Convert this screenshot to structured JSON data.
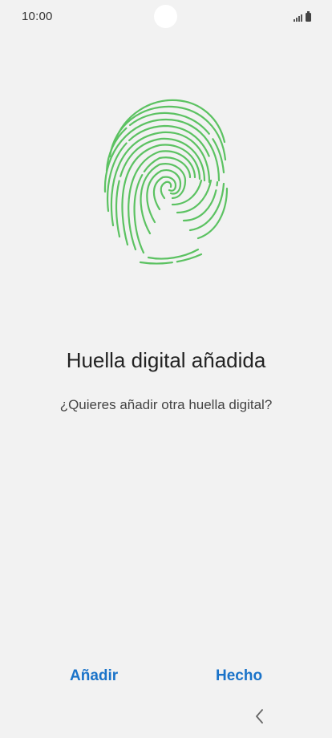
{
  "status_bar": {
    "time": "10:00"
  },
  "fingerprint": {
    "icon": "fingerprint-icon",
    "color": "#5cc262"
  },
  "title": "Huella digital añadida",
  "subtitle": "¿Quieres añadir otra huella digital?",
  "actions": {
    "add_label": "Añadir",
    "done_label": "Hecho",
    "color": "#1a73c9"
  },
  "nav": {
    "back_icon": "back-chevron-icon"
  }
}
